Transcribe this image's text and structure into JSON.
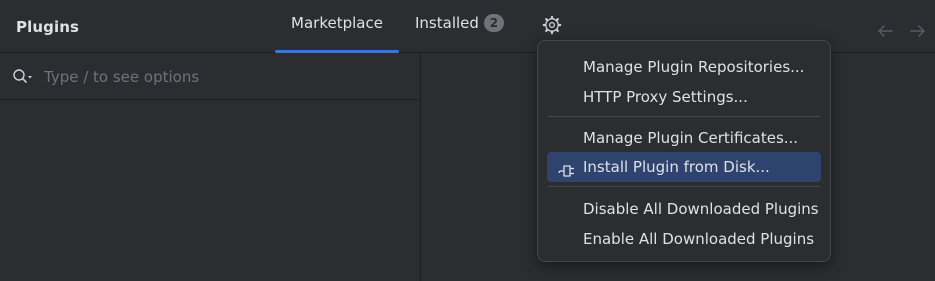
{
  "header": {
    "title": "Plugins",
    "tabs": [
      {
        "label": "Marketplace",
        "selected": true
      },
      {
        "label": "Installed",
        "badge": "2",
        "selected": false
      }
    ],
    "settings_icon": "gear-icon",
    "nav": {
      "back_icon": "arrow-left-icon",
      "forward_icon": "arrow-right-icon"
    }
  },
  "search": {
    "icon": "search-icon",
    "placeholder": "Type / to see options",
    "value": ""
  },
  "menu": {
    "items": [
      {
        "label": "Manage Plugin Repositories..."
      },
      {
        "label": "HTTP Proxy Settings..."
      },
      {
        "label": "Manage Plugin Certificates..."
      },
      {
        "label": "Install Plugin from Disk...",
        "selected": true,
        "icon": "plugin-plug-icon"
      },
      {
        "label": "Disable All Downloaded Plugins"
      },
      {
        "label": "Enable All Downloaded Plugins"
      }
    ]
  },
  "colors": {
    "background": "#2b2d30",
    "accent": "#3574f0",
    "selection": "#2e436e",
    "text": "#dfe1e5",
    "placeholder": "#6f737a",
    "border": "#1e1f22"
  }
}
